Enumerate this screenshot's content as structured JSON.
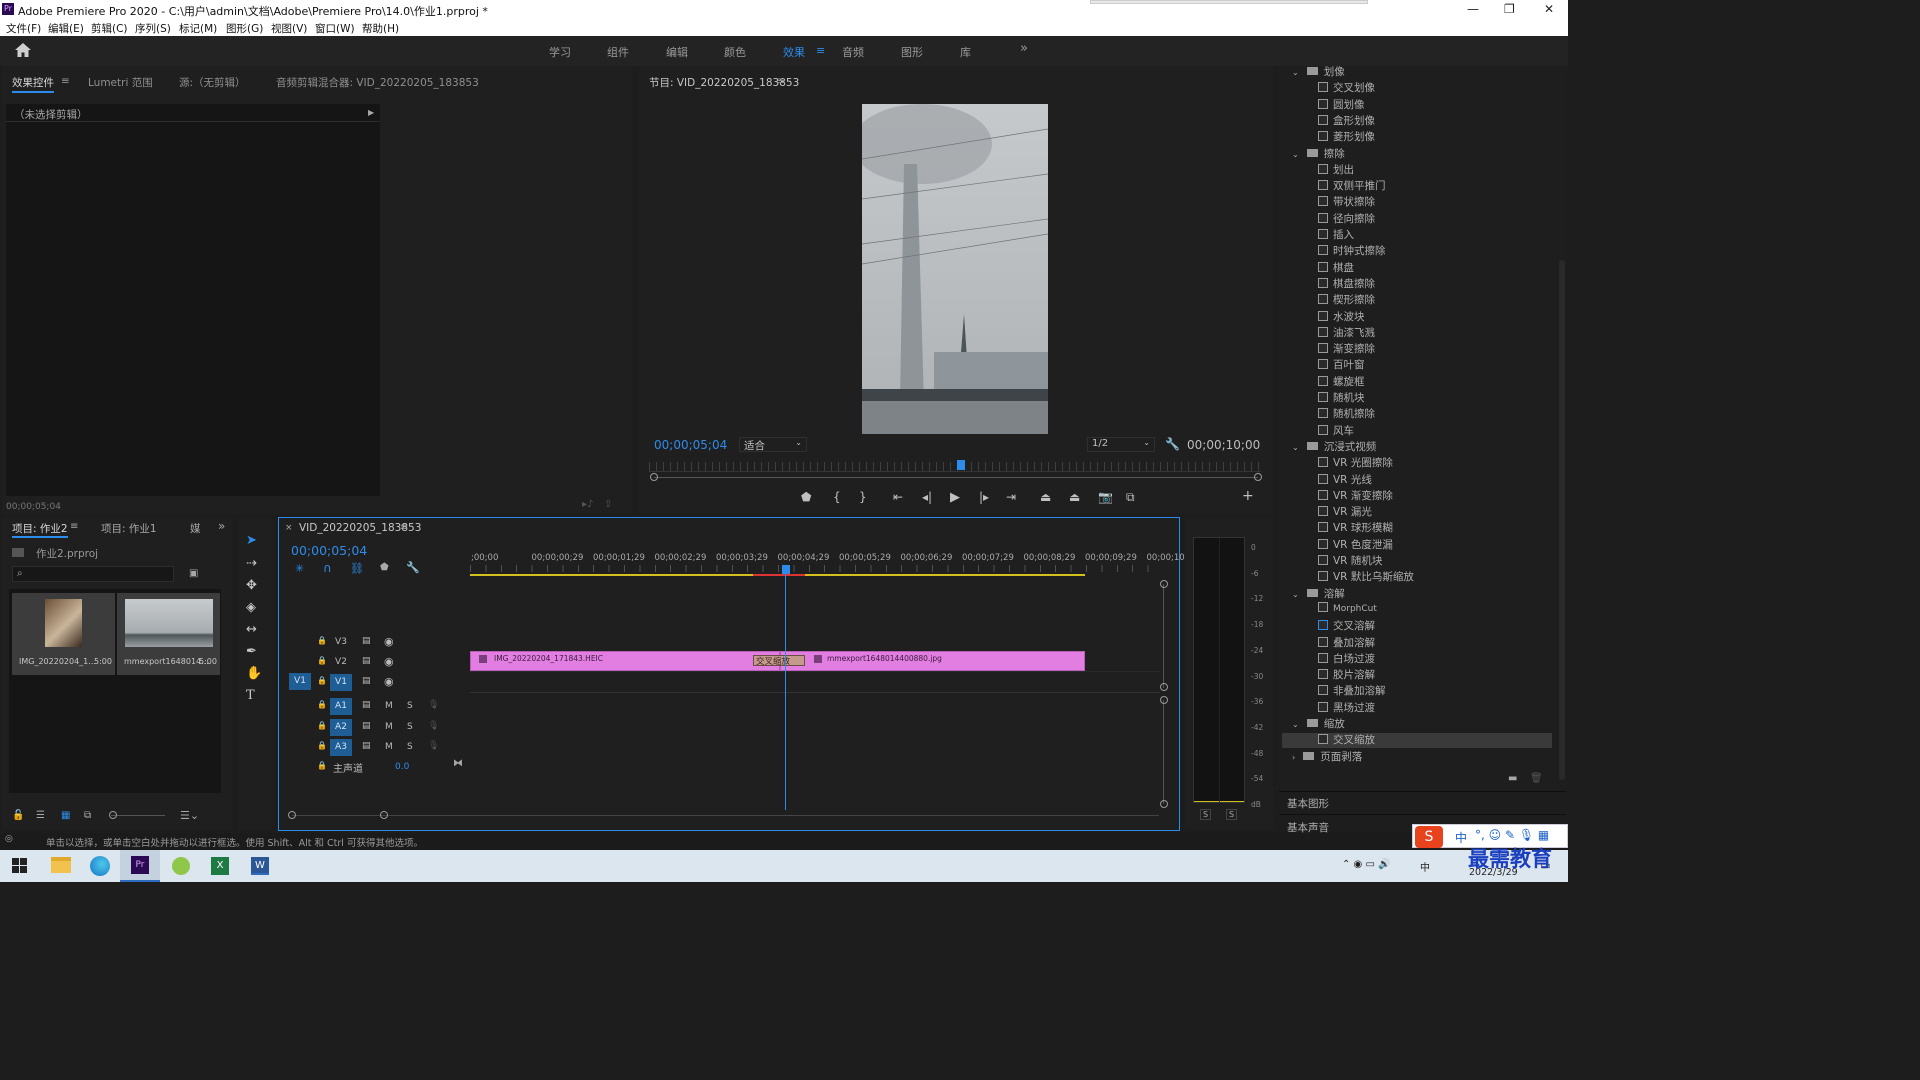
{
  "window": {
    "title": "Adobe Premiere Pro 2020 - C:\\用户\\admin\\文档\\Adobe\\Premiere Pro\\14.0\\作业1.prproj *",
    "min": "—",
    "max": "❐",
    "close": "✕"
  },
  "menu": [
    "文件(F)",
    "编辑(E)",
    "剪辑(C)",
    "序列(S)",
    "标记(M)",
    "图形(G)",
    "视图(V)",
    "窗口(W)",
    "帮助(H)"
  ],
  "workspaces": [
    "学习",
    "组件",
    "编辑",
    "颜色",
    "效果",
    "音频",
    "图形",
    "库"
  ],
  "workspace_active": "效果",
  "more": "»",
  "source_tabs": {
    "effect_controls": "效果控件",
    "lumetri": "Lumetri 范围",
    "source": "源:（无剪辑）",
    "audio_mixer": "音频剪辑混合器: VID_20220205_183853"
  },
  "effect_controls": {
    "no_clip": "（未选择剪辑）",
    "timecode": "00;00;05;04"
  },
  "program": {
    "title": "节目: VID_20220205_183853",
    "timecode": "00;00;05;04",
    "fit": "适合",
    "resolution": "1/2",
    "duration": "00;00;10;00"
  },
  "project": {
    "tab1": "项目: 作业2",
    "tab2": "项目: 作业1",
    "tab3": "媒",
    "file": "作业2.prproj",
    "items": [
      {
        "name": "IMG_20220204_1...",
        "dur": "5:00"
      },
      {
        "name": "mmexport1648014...",
        "dur": "5:00"
      }
    ]
  },
  "timeline": {
    "title": "VID_20220205_183853",
    "timecode": "00;00;05;04",
    "ruler": [
      ";00;00",
      "00;00;00;29",
      "00;00;01;29",
      "00;00;02;29",
      "00;00;03;29",
      "00;00;04;29",
      "00;00;05;29",
      "00;00;06;29",
      "00;00;07;29",
      "00;00;08;29",
      "00;00;09;29",
      "00;00;10;"
    ],
    "tracks": [
      "V3",
      "V2",
      "V1",
      "A1",
      "A2",
      "A3"
    ],
    "src_v": "V1",
    "master": "主声道",
    "master_val": "0.0",
    "clip1": "IMG_20220204_171843.HEIC",
    "clip2": "mmexport1648014400880.jpg",
    "transition": "交叉缩放"
  },
  "meter": {
    "scale": [
      "0",
      "-6",
      "-12",
      "-18",
      "-24",
      "-30",
      "-36",
      "-42",
      "-48",
      "-54",
      "dB"
    ],
    "s": "S"
  },
  "effects": [
    {
      "kind": "folder",
      "label": "划像"
    },
    {
      "kind": "item",
      "label": "交叉划像"
    },
    {
      "kind": "item",
      "label": "圆划像"
    },
    {
      "kind": "item",
      "label": "盒形划像"
    },
    {
      "kind": "item",
      "label": "菱形划像"
    },
    {
      "kind": "folder",
      "label": "擦除"
    },
    {
      "kind": "item",
      "label": "划出"
    },
    {
      "kind": "item",
      "label": "双侧平推门"
    },
    {
      "kind": "item",
      "label": "带状擦除"
    },
    {
      "kind": "item",
      "label": "径向擦除"
    },
    {
      "kind": "item",
      "label": "插入"
    },
    {
      "kind": "item",
      "label": "时钟式擦除"
    },
    {
      "kind": "item",
      "label": "棋盘"
    },
    {
      "kind": "item",
      "label": "棋盘擦除"
    },
    {
      "kind": "item",
      "label": "楔形擦除"
    },
    {
      "kind": "item",
      "label": "水波块"
    },
    {
      "kind": "item",
      "label": "油漆飞溅"
    },
    {
      "kind": "item",
      "label": "渐变擦除"
    },
    {
      "kind": "item",
      "label": "百叶窗"
    },
    {
      "kind": "item",
      "label": "螺旋框"
    },
    {
      "kind": "item",
      "label": "随机块"
    },
    {
      "kind": "item",
      "label": "随机擦除"
    },
    {
      "kind": "item",
      "label": "风车"
    },
    {
      "kind": "folder",
      "label": "沉浸式视频"
    },
    {
      "kind": "item",
      "label": "VR 光圈擦除"
    },
    {
      "kind": "item",
      "label": "VR 光线"
    },
    {
      "kind": "item",
      "label": "VR 渐变擦除"
    },
    {
      "kind": "item",
      "label": "VR 漏光"
    },
    {
      "kind": "item",
      "label": "VR 球形模糊"
    },
    {
      "kind": "item",
      "label": "VR 色度泄漏"
    },
    {
      "kind": "item",
      "label": "VR 随机块"
    },
    {
      "kind": "item",
      "label": "VR 默比乌斯缩放"
    },
    {
      "kind": "folder",
      "label": "溶解"
    },
    {
      "kind": "item",
      "label": "MorphCut"
    },
    {
      "kind": "item",
      "label": "交叉溶解"
    },
    {
      "kind": "item",
      "label": "叠加溶解"
    },
    {
      "kind": "item",
      "label": "白场过渡"
    },
    {
      "kind": "item",
      "label": "胶片溶解"
    },
    {
      "kind": "item",
      "label": "非叠加溶解"
    },
    {
      "kind": "item",
      "label": "黑场过渡"
    },
    {
      "kind": "folder",
      "label": "缩放"
    },
    {
      "kind": "item",
      "label": "交叉缩放"
    },
    {
      "kind": "folder",
      "label": "页面剥落"
    }
  ],
  "effects_bottom": {
    "basic_graphics": "基本图形",
    "basic_sound": "基本声音"
  },
  "status": "单击以选择，或单击空白处并拖动以进行框选。使用 Shift、Alt 和 Ctrl 可获得其他选项。",
  "taskbar": {
    "date": "2022/3/29",
    "ime": "中",
    "watermark": "最需教育"
  }
}
